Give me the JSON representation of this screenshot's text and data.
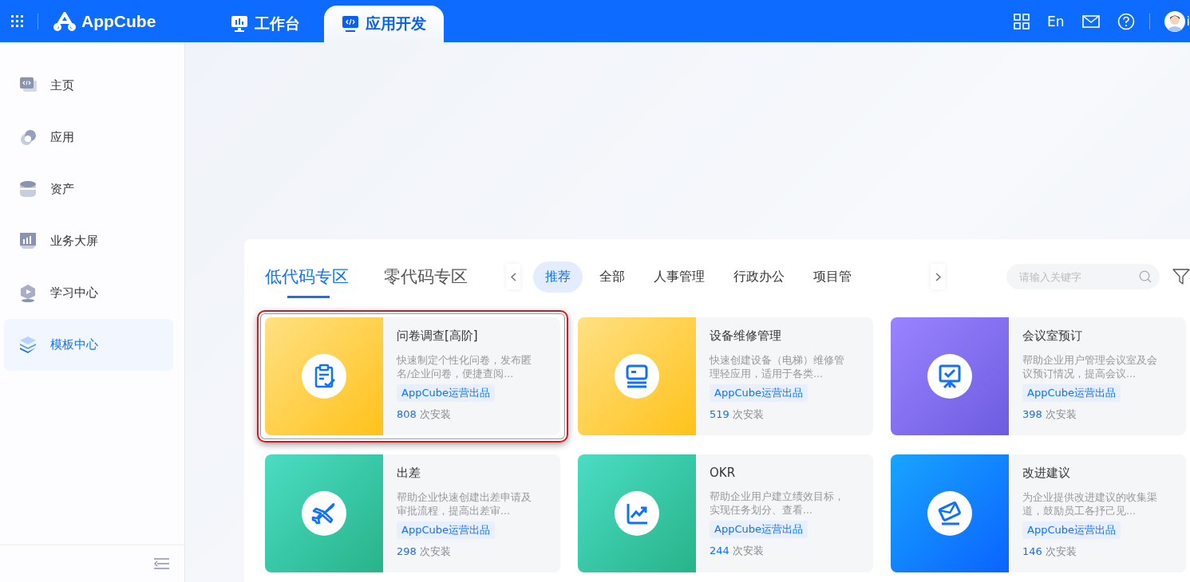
{
  "header": {
    "logo": "AppCube",
    "tabs": [
      {
        "label": "工作台",
        "selected": false
      },
      {
        "label": "应用开发",
        "selected": true
      }
    ],
    "language": "En",
    "user": "i"
  },
  "sidebar": {
    "items": [
      {
        "label": "主页",
        "selected": false
      },
      {
        "label": "应用",
        "selected": false
      },
      {
        "label": "资产",
        "selected": false
      },
      {
        "label": "业务大屏",
        "selected": false
      },
      {
        "label": "学习中心",
        "selected": false
      },
      {
        "label": "模板中心",
        "selected": true
      }
    ]
  },
  "zones": [
    {
      "label": "低代码专区",
      "selected": true
    },
    {
      "label": "零代码专区",
      "selected": false
    }
  ],
  "categories": [
    {
      "label": "推荐",
      "selected": true
    },
    {
      "label": "全部",
      "selected": false
    },
    {
      "label": "人事管理",
      "selected": false
    },
    {
      "label": "行政办公",
      "selected": false
    },
    {
      "label": "项目管",
      "selected": false
    }
  ],
  "search": {
    "placeholder": "请输入关键字"
  },
  "templates": [
    {
      "kind": "amber",
      "title": "问卷调查[高阶]",
      "description": "快速制定个性化问卷，发布匿名/企业问卷，便捷查阅...",
      "tag": "AppCube运营出品",
      "installs": "808",
      "installs_label": "次安装",
      "highlighted": true
    },
    {
      "kind": "amber",
      "title": "设备维修管理",
      "description": "快速创建设备（电梯）维修管理轻应用，适用于各类...",
      "tag": "AppCube运营出品",
      "installs": "519",
      "installs_label": "次安装",
      "highlighted": false
    },
    {
      "kind": "violet",
      "title": "会议室预订",
      "description": "帮助企业用户管理会议室及会议预订情况，提高会议...",
      "tag": "AppCube运营出品",
      "installs": "398",
      "installs_label": "次安装",
      "highlighted": false
    },
    {
      "kind": "teal",
      "title": "出差",
      "description": "帮助企业快速创建出差申请及审批流程，提高出差审...",
      "tag": "AppCube运营出品",
      "installs": "298",
      "installs_label": "次安装",
      "highlighted": false
    },
    {
      "kind": "teal",
      "title": "OKR",
      "description": "帮助企业用户建立绩效目标，实现任务划分、查看...",
      "tag": "AppCube运营出品",
      "installs": "244",
      "installs_label": "次安装",
      "highlighted": false
    },
    {
      "kind": "azure",
      "title": "改进建议",
      "description": "为企业提供改进建议的收集渠道，鼓励员工各抒己见...",
      "tag": "AppCube运营出品",
      "installs": "146",
      "installs_label": "次安装",
      "highlighted": false
    }
  ]
}
